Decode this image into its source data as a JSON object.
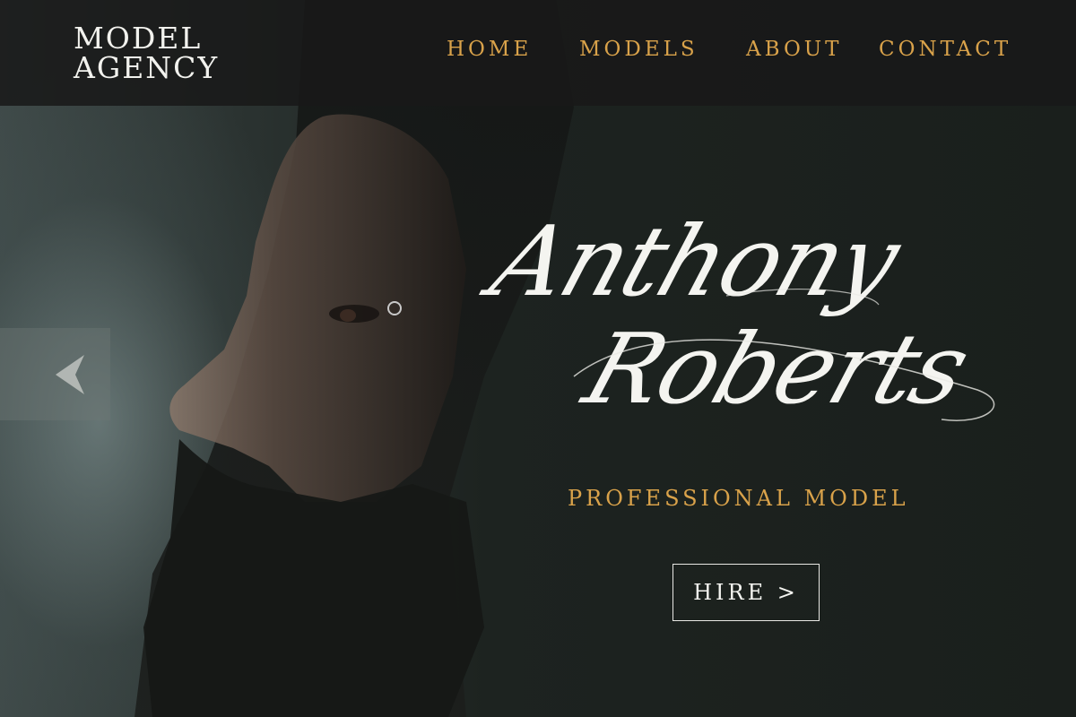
{
  "brand": {
    "line1": "MODEL",
    "line2": "AGENCY"
  },
  "nav": {
    "items": [
      {
        "label": "HOME"
      },
      {
        "label": "MODELS"
      },
      {
        "label": "ABOUT"
      },
      {
        "label": "CONTACT"
      }
    ]
  },
  "hero": {
    "name_first": "Anthony",
    "name_last": "Roberts",
    "subtitle": "PROFESSIONAL MODEL",
    "cta_label": "HIRE >",
    "prev_icon": "chevron-left-icon"
  },
  "colors": {
    "accent": "#d9a24a",
    "text": "#f4f4f0",
    "header_bg": "#181818",
    "background": "#1b1f1c"
  }
}
